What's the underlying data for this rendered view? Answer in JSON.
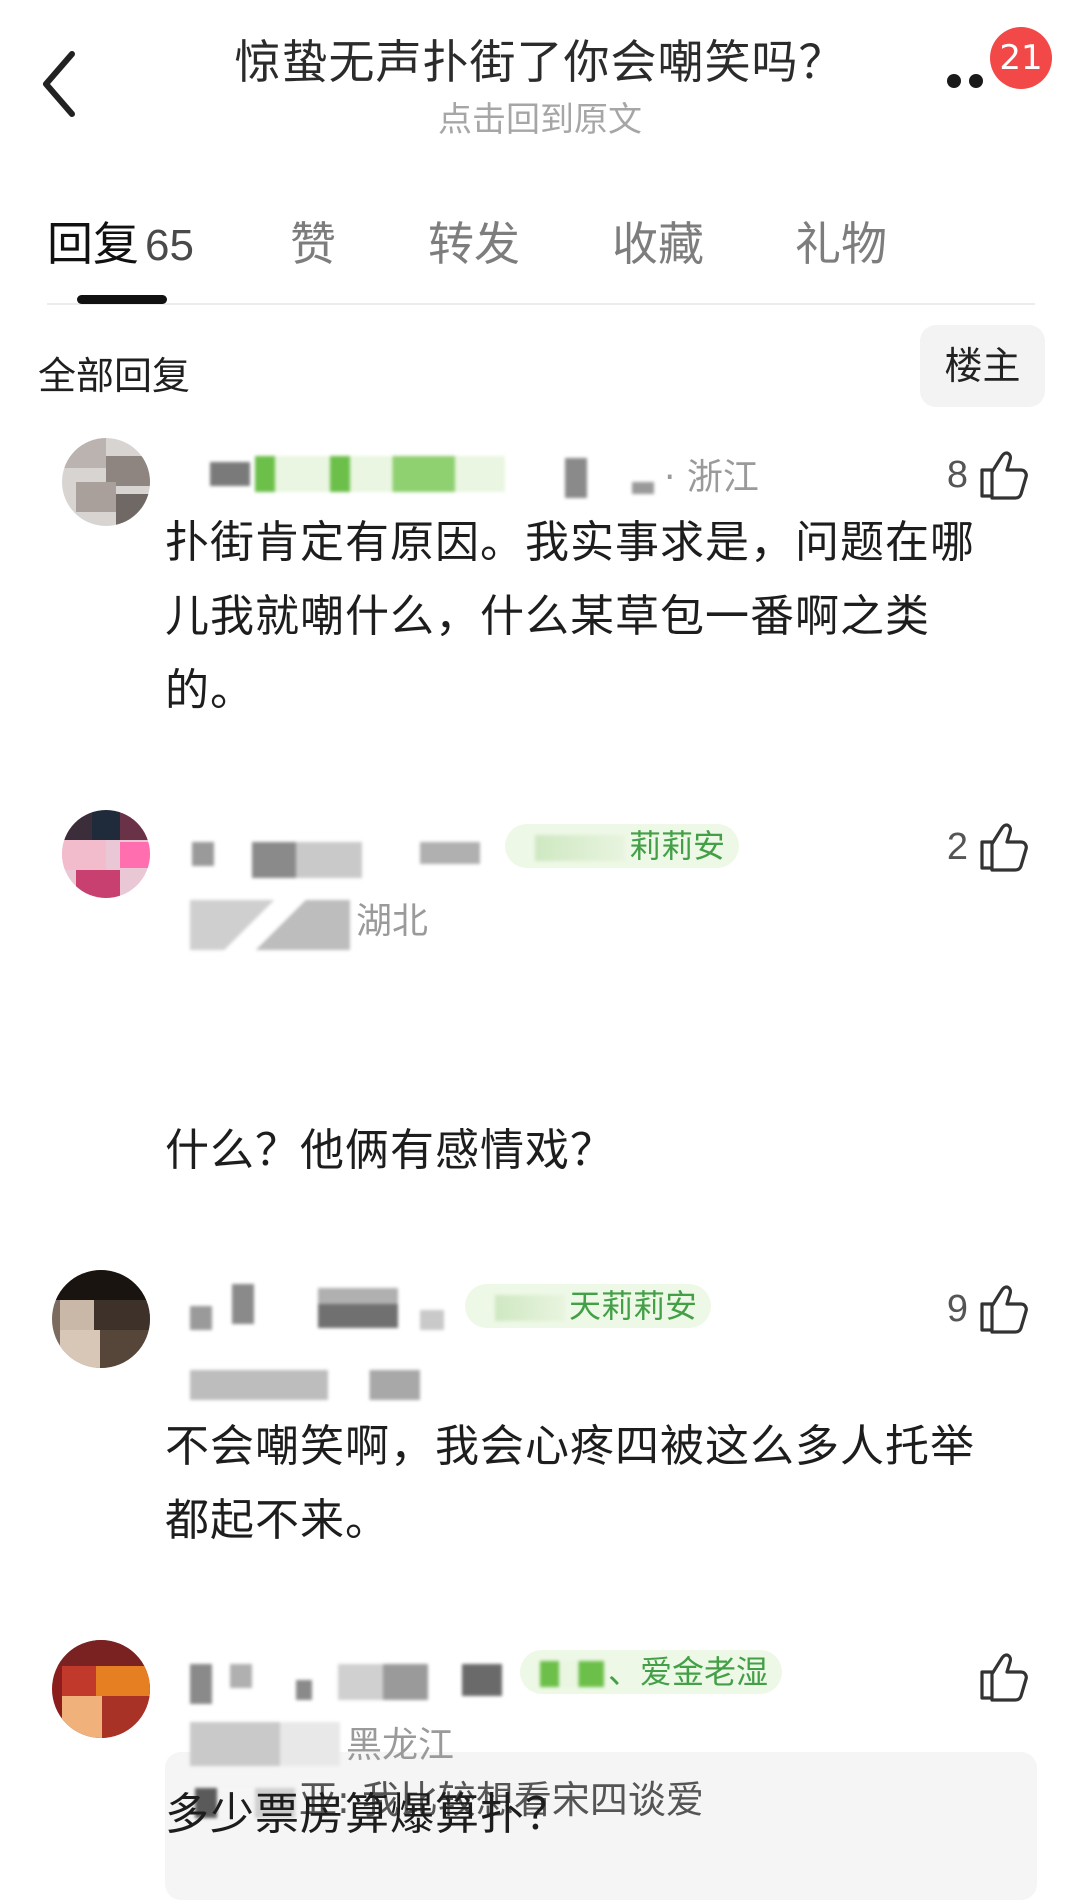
{
  "header": {
    "title": "惊蛰无声扑街了你会嘲笑吗？",
    "subtitle": "点击回到原文",
    "notification_count": "21"
  },
  "tabs": [
    {
      "label": "回复",
      "count": "65"
    },
    {
      "label": "赞"
    },
    {
      "label": "转发"
    },
    {
      "label": "收藏"
    },
    {
      "label": "礼物"
    }
  ],
  "filter": {
    "section_label": "全部回复",
    "owner_button": "楼主"
  },
  "comments": [
    {
      "region": "· 浙江",
      "likes": "8",
      "text": "扑街肯定有原因。我实事求是，问题在哪儿我就嘲什么，什么某草包一番啊之类的。"
    },
    {
      "tag": "莉莉安",
      "region": "湖北",
      "likes": "2",
      "quote": "我比较想看宋四谈爱",
      "quote_author_suffix": "亚:",
      "text": "什么？他俩有感情戏？"
    },
    {
      "tag": "天莉莉安",
      "likes": "9",
      "text": "不会嘲笑啊，我会心疼四被这么多人托举都起不来。"
    },
    {
      "tag": "、爱金老湿",
      "region": "黑龙江",
      "likes": "",
      "text": "多少票房算爆算扑？"
    }
  ],
  "colors": {
    "badge": "#f24848",
    "tag_green": "#43a047",
    "tag_bg": "#eef8e6"
  }
}
